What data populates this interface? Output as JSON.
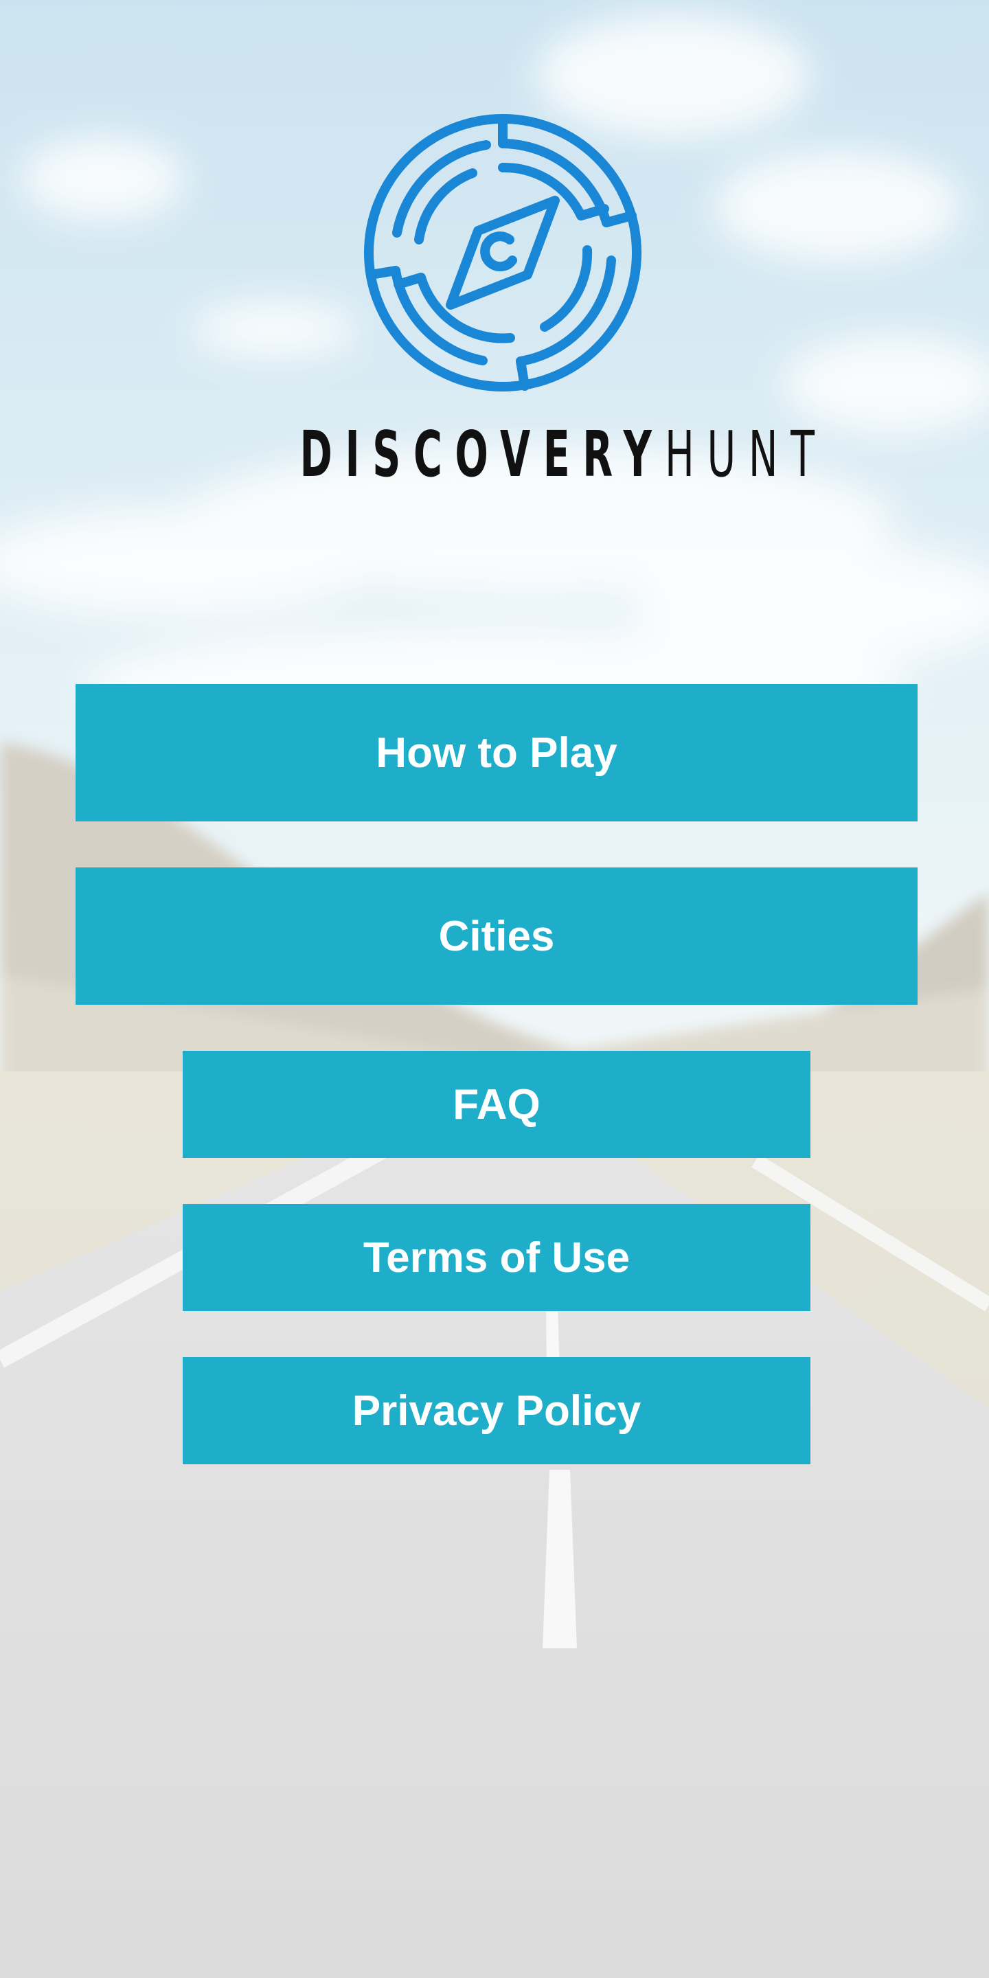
{
  "app": {
    "brand_bold": "DISCOVERY",
    "brand_light": "HUNT",
    "logo_icon": "compass-maze-icon",
    "brand_color": "#1a87d6"
  },
  "background": {
    "scene": "road-landscape-background",
    "sky_color": "#cfe6f0",
    "road_color": "#dcdcdc"
  },
  "menu": {
    "accent": "#1eaec9",
    "items": [
      {
        "label": "How to Play"
      },
      {
        "label": "Cities"
      },
      {
        "label": "FAQ"
      },
      {
        "label": "Terms of Use"
      },
      {
        "label": "Privacy Policy"
      }
    ]
  }
}
